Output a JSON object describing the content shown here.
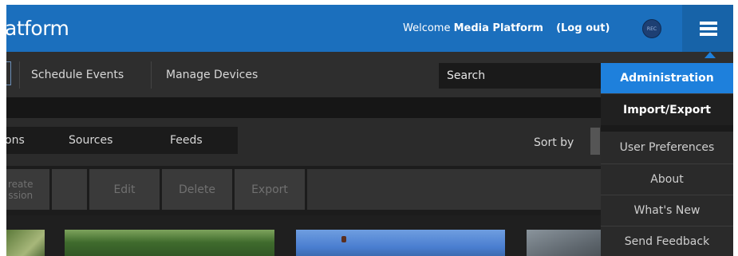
{
  "header": {
    "brand": "atform",
    "welcome_prefix": "Welcome",
    "user_name": "Media Platform",
    "logout_label": "(Log out)",
    "rec_badge": "REC",
    "menu_icon": "hamburger-icon"
  },
  "nav": {
    "items": [
      "Schedule Events",
      "Manage Devices"
    ],
    "search_placeholder": "Search"
  },
  "filters": {
    "tabs": [
      "ons",
      "Sources",
      "Feeds"
    ],
    "sort_label": "Sort by"
  },
  "toolbar": {
    "create_label": "reate\nssion",
    "edit_label": "Edit",
    "delete_label": "Delete",
    "export_label": "Export"
  },
  "menu": {
    "items": [
      "Administration",
      "Import/Export",
      "User Preferences",
      "About",
      "What's New",
      "Send Feedback"
    ],
    "active_index": 0
  },
  "colors": {
    "brand_blue": "#1b6fbd",
    "menu_active": "#1e80dc",
    "dark_bg": "#1f1f1f"
  }
}
